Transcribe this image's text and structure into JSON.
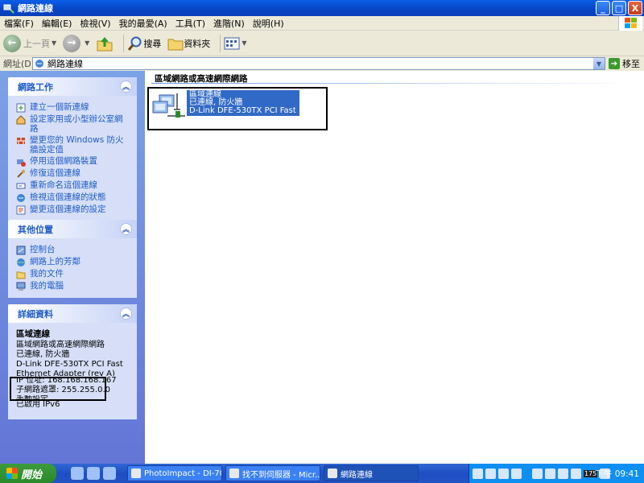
{
  "window": {
    "title": "網路連線",
    "minimize": "_",
    "maximize": "□",
    "close": "X"
  },
  "menu": [
    "檔案(F)",
    "編輯(E)",
    "檢視(V)",
    "我的最愛(A)",
    "工具(T)",
    "進階(N)",
    "說明(H)"
  ],
  "toolbar": {
    "back_label": "上一頁",
    "search_label": "搜尋",
    "folders_label": "資料夾"
  },
  "address": {
    "label": "網址(D)",
    "value": "網路連線",
    "go_label": "移至"
  },
  "network_tasks": {
    "title": "網路工作",
    "items": [
      "建立一個新連線",
      "設定家用或小型辦公室網路",
      "變更您的 Windows 防火牆設定值",
      "停用這個網路裝置",
      "修復這個連線",
      "重新命名這個連線",
      "檢視這個連線的狀態",
      "變更這個連線的設定"
    ]
  },
  "other_places": {
    "title": "其他位置",
    "items": [
      "控制台",
      "網路上的芳鄰",
      "我的文件",
      "我的電腦"
    ]
  },
  "details": {
    "title": "詳細資料",
    "name": "區域連線",
    "type": "區域網路或高速網際網路",
    "status": "已連線, 防火牆",
    "adapter_line1": "D-Link DFE-530TX PCI Fast",
    "adapter_line2": "Ethernet Adapter (rev A)",
    "ip": "IP 位址: 168.168.168.167",
    "mask": "子網路遮罩: 255.255.0.0",
    "dhcp": "手動設定",
    "ipv6": "已啟用 IPv6"
  },
  "main": {
    "group_header": "區域網路或高速網際網路",
    "connection": {
      "name": "區域連線",
      "status": "已連線, 防火牆",
      "adapter": "D-Link DFE-530TX PCI Fast Ether..."
    }
  },
  "taskbar": {
    "start_label": "開始",
    "tasks": [
      "PhotoImpact - DI-704...",
      "找不到伺服器 - Micr...",
      "網路連線"
    ],
    "tray_badge": "175",
    "clock": "下午 09:41"
  }
}
